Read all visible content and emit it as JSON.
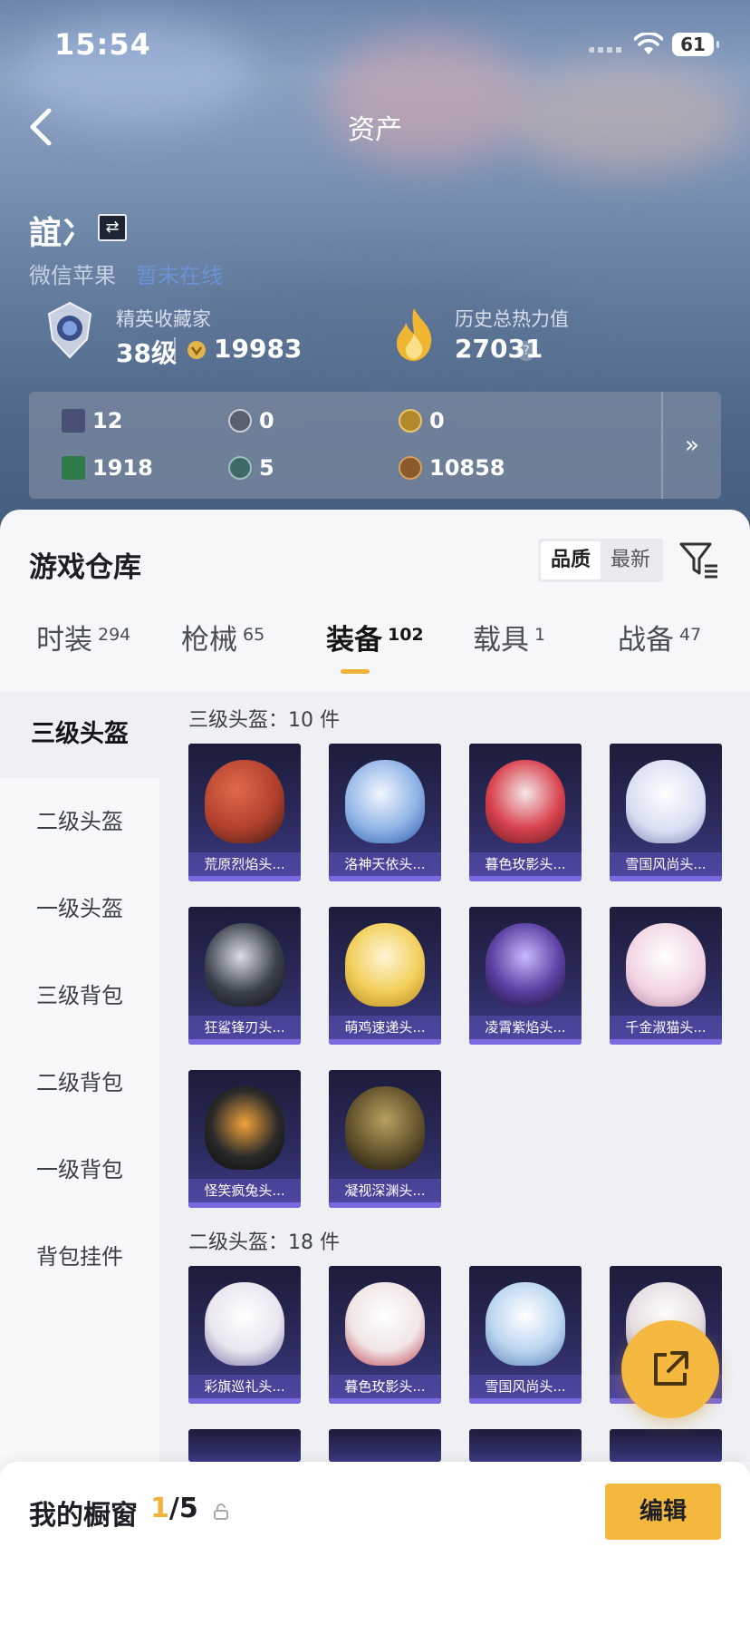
{
  "status_bar": {
    "time": "15:54",
    "battery": "61"
  },
  "nav": {
    "title": "资产"
  },
  "profile": {
    "username": "誼冫",
    "platform": "微信苹果",
    "platform_status": "暂未在线",
    "rank": {
      "title": "精英收藏家",
      "level": "38级",
      "points": "19983"
    },
    "heat": {
      "title": "历史总热力值",
      "value": "27031",
      "help": "?"
    }
  },
  "resources": [
    {
      "icon": "purple-card-icon",
      "value": "12",
      "color": "#4a4f75"
    },
    {
      "icon": "silver-coin-icon",
      "value": "0",
      "color": "#5a6070"
    },
    {
      "icon": "gold-token-icon",
      "value": "0",
      "color": "#b08a2a"
    },
    {
      "icon": "green-card-icon",
      "value": "1918",
      "color": "#2f7a4a"
    },
    {
      "icon": "teal-orb-icon",
      "value": "5",
      "color": "#3f6a6a"
    },
    {
      "icon": "bronze-coin-icon",
      "value": "10858",
      "color": "#8a5a2a"
    }
  ],
  "warehouse": {
    "title": "游戏仓库",
    "sort_options": [
      "品质",
      "最新"
    ],
    "sort_selected": "品质",
    "tabs": [
      {
        "label": "时装",
        "count": "294"
      },
      {
        "label": "枪械",
        "count": "65"
      },
      {
        "label": "装备",
        "count": "102"
      },
      {
        "label": "载具",
        "count": "1"
      },
      {
        "label": "战备",
        "count": "47"
      }
    ],
    "active_tab": "装备",
    "categories": [
      "三级头盔",
      "二级头盔",
      "一级头盔",
      "三级背包",
      "二级背包",
      "一级背包",
      "背包挂件"
    ],
    "active_category": "三级头盔",
    "sections": [
      {
        "heading": "三级头盔：10 件",
        "items": [
          {
            "name": "荒原烈焰头...",
            "color": "#b2402e"
          },
          {
            "name": "洛神天依头...",
            "color": "#8fb4e6"
          },
          {
            "name": "暮色玫影头...",
            "color": "#d9434f"
          },
          {
            "name": "雪国风尚头...",
            "color": "#d8ddf2"
          },
          {
            "name": "狂鲨锋刃头...",
            "color": "#3a3f4c"
          },
          {
            "name": "萌鸡速递头...",
            "color": "#f2cf5b"
          },
          {
            "name": "凌霄紫焰头...",
            "color": "#5a3fa0"
          },
          {
            "name": "千金淑猫头...",
            "color": "#f1d3e2"
          },
          {
            "name": "怪笑疯兔头...",
            "color": "#2a2a2a"
          },
          {
            "name": "凝视深渊头...",
            "color": "#6a5a30"
          }
        ]
      },
      {
        "heading": "二级头盔：18 件",
        "items": [
          {
            "name": "彩旗巡礼头...",
            "color": "#e9e6ef"
          },
          {
            "name": "暮色玫影头...",
            "color": "#f0e6e6"
          },
          {
            "name": "雪国风尚头...",
            "color": "#bcd6f0"
          },
          {
            "name": "",
            "color": "#e6dfe4"
          }
        ]
      }
    ]
  },
  "showcase": {
    "title": "我的橱窗",
    "current": "1",
    "total": "/5",
    "edit_label": "编辑"
  }
}
